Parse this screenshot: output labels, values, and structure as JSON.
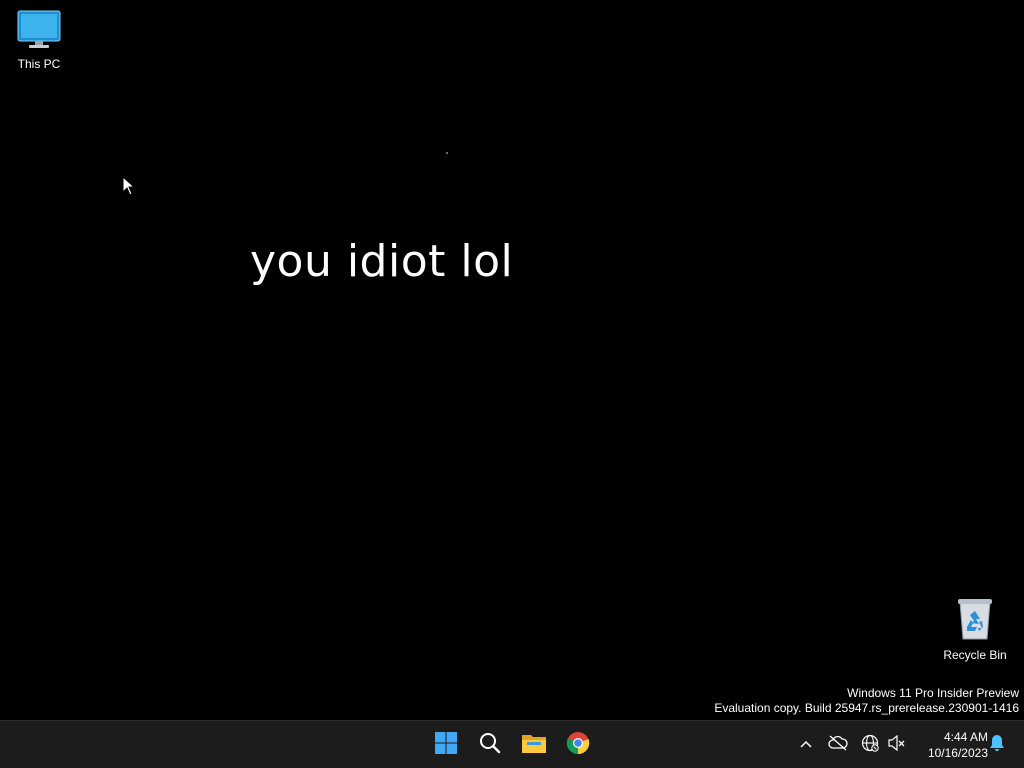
{
  "desktop": {
    "icons": [
      {
        "label": "This PC",
        "icon": "monitor-icon"
      },
      {
        "label": "Recycle Bin",
        "icon": "recycle-bin-icon"
      }
    ],
    "message": "you idiot lol",
    "watermark": {
      "line1": "Windows 11 Pro Insider Preview",
      "line2": "Evaluation copy. Build 25947.rs_prerelease.230901-1416"
    }
  },
  "taskbar": {
    "apps": [
      {
        "name": "Start",
        "icon": "windows-logo-icon"
      },
      {
        "name": "Search",
        "icon": "search-icon"
      },
      {
        "name": "File Explorer",
        "icon": "folder-icon"
      },
      {
        "name": "Google Chrome",
        "icon": "chrome-icon"
      }
    ],
    "tray": {
      "icons": [
        "chevron-up-icon",
        "cloud-off-icon",
        "network-globe-icon",
        "volume-muted-icon"
      ],
      "time": "4:44 AM",
      "date": "10/16/2023",
      "notification_icon": "bell-icon"
    }
  },
  "colors": {
    "desktop_background": "#000000",
    "taskbar_background": "#1c1c1c",
    "accent_blue": "#3a9bdc",
    "notification_blue": "#4cc2ff"
  }
}
